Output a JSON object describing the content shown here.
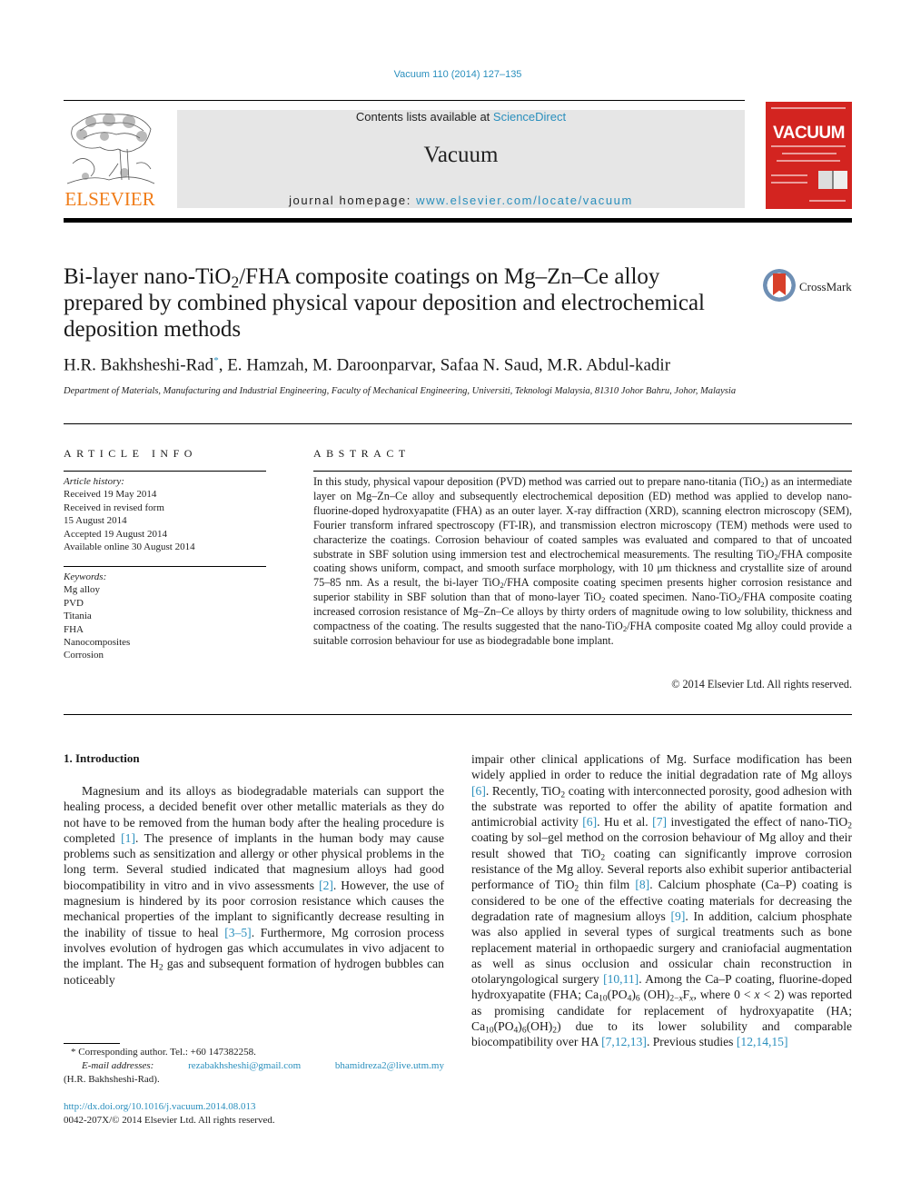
{
  "header": {
    "journal_ref": "Vacuum 110 (2014) 127–135",
    "contents_prefix": "Contents lists available at ",
    "contents_link": "ScienceDirect",
    "journal_name": "Vacuum",
    "homepage_prefix": "journal homepage: ",
    "homepage_link": "www.elsevier.com/locate/vacuum",
    "publisher_logo_text": "ELSEVIER",
    "cover_title": "VACUUM",
    "crossmark_label": "CrossMark"
  },
  "article": {
    "title_part1": "Bi-layer nano-TiO",
    "title_sub": "2",
    "title_part2": "/FHA composite coatings on Mg–Zn–Ce alloy prepared by combined physical vapour deposition and electrochemical deposition methods",
    "first_author": "H.R. Bakhsheshi-Rad",
    "corresponding_mark": "*",
    "other_authors": ", E. Hamzah, M. Daroonparvar, Safaa N. Saud, M.R. Abdul-kadir",
    "affiliation": "Department of Materials, Manufacturing and Industrial Engineering, Faculty of Mechanical Engineering, Universiti, Teknologi Malaysia, 81310 Johor Bahru, Johor, Malaysia"
  },
  "article_info": {
    "heading": "ARTICLE INFO",
    "history_label": "Article history:",
    "history": [
      "Received 19 May 2014",
      "Received in revised form",
      "15 August 2014",
      "Accepted 19 August 2014",
      "Available online 30 August 2014"
    ],
    "keywords_label": "Keywords:",
    "keywords": [
      "Mg alloy",
      "PVD",
      "Titania",
      "FHA",
      "Nanocomposites",
      "Corrosion"
    ]
  },
  "abstract": {
    "heading": "ABSTRACT",
    "text_html": "In this study, physical vapour deposition (PVD) method was carried out to prepare nano-titania (TiO<sub>2</sub>) as an intermediate layer on Mg–Zn–Ce alloy and subsequently electrochemical deposition (ED) method was applied to develop nano-fluorine-doped hydroxyapatite (FHA) as an outer layer. X-ray diffraction (XRD), scanning electron microscopy (SEM), Fourier transform infrared spectroscopy (FT-IR), and transmission electron microscopy (TEM) methods were used to characterize the coatings. Corrosion behaviour of coated samples was evaluated and compared to that of uncoated substrate in SBF solution using immersion test and electrochemical measurements. The resulting TiO<sub>2</sub>/FHA composite coating shows uniform, compact, and smooth surface morphology, with 10 μm thickness and crystallite size of around 75–85 nm. As a result, the bi-layer TiO<sub>2</sub>/FHA composite coating specimen presents higher corrosion resistance and superior stability in SBF solution than that of mono-layer TiO<sub>2</sub> coated specimen. Nano-TiO<sub>2</sub>/FHA composite coating increased corrosion resistance of Mg–Zn–Ce alloys by thirty orders of magnitude owing to low solubility, thickness and compactness of the coating. The results suggested that the nano-TiO<sub>2</sub>/FHA composite coated Mg alloy could provide a suitable corrosion behaviour for use as biodegradable bone implant.",
    "copyright": "© 2014 Elsevier Ltd. All rights reserved."
  },
  "body": {
    "section_heading": "1.  Introduction",
    "left_html": "Magnesium and its alloys as biodegradable materials can support the healing process, a decided benefit over other metallic materials as they do not have to be removed from the human body after the healing procedure is completed <a class=\"link\">[1]</a>. The presence of implants in the human body may cause problems such as sensitization and allergy or other physical problems in the long term. Several studied indicated that magnesium alloys had good biocompatibility in vitro and in vivo assessments <a class=\"link\">[2]</a>. However, the use of magnesium is hindered by its poor corrosion resistance which causes the mechanical properties of the implant to significantly decrease resulting in the inability of tissue to heal <a class=\"link\">[3–5]</a>. Furthermore, Mg corrosion process involves evolution of hydrogen gas which accumulates in vivo adjacent to the implant. The H<sub>2</sub> gas and subsequent formation of hydrogen bubbles can noticeably",
    "right_html": "impair other clinical applications of Mg. Surface modification has been widely applied in order to reduce the initial degradation rate of Mg alloys <a class=\"link\">[6]</a>. Recently, TiO<sub>2</sub> coating with interconnected porosity, good adhesion with the substrate was reported to offer the ability of apatite formation and antimicrobial activity <a class=\"link\">[6]</a>. Hu et al. <a class=\"link\">[7]</a> investigated the effect of nano-TiO<sub>2</sub> coating by sol–gel method on the corrosion behaviour of Mg alloy and their result showed that TiO<sub>2</sub> coating can significantly improve corrosion resistance of the Mg alloy. Several reports also exhibit superior antibacterial performance of TiO<sub>2</sub> thin film <a class=\"link\">[8]</a>. Calcium phosphate (Ca–P) coating is considered to be one of the effective coating materials for decreasing the degradation rate of magnesium alloys <a class=\"link\">[9]</a>. In addition, calcium phosphate was also applied in several types of surgical treatments such as bone replacement material in orthopaedic surgery and craniofacial augmentation as well as sinus occlusion and ossicular chain reconstruction in otolaryngological surgery <a class=\"link\">[10,11]</a>. Among the Ca–P coating, fluorine-doped hydroxyapatite (FHA; Ca<sub>10</sub>(PO<sub>4</sub>)<sub>6</sub> (OH)<sub>2−<i>x</i></sub>F<sub><i>x</i></sub>, where 0 &lt; <i>x</i> &lt; 2) was reported as promising candidate for replacement of hydroxyapatite (HA; Ca<sub>10</sub>(PO<sub>4</sub>)<sub>6</sub>(OH)<sub>2</sub>) due to its lower solubility and comparable biocompatibility over HA <a class=\"link\">[7,12,13]</a>. Previous studies <a class=\"link\">[12,14,15]</a>"
  },
  "footnotes": {
    "corresponding": "* Corresponding author. Tel.: +60 147382258.",
    "email_label": "E-mail addresses:",
    "email1": "rezabakhsheshi@gmail.com",
    "email2": "bhamidreza2@live.utm.my",
    "email_owner": "(H.R. Bakhsheshi-Rad).",
    "doi": "http://dx.doi.org/10.1016/j.vacuum.2014.08.013",
    "issn_line": "0042-207X/© 2014 Elsevier Ltd. All rights reserved."
  },
  "colors": {
    "link": "#2a8fbd",
    "elsevier_orange": "#f07d1a",
    "cover_red": "#d32420",
    "masthead_gray": "#e6e6e6"
  }
}
